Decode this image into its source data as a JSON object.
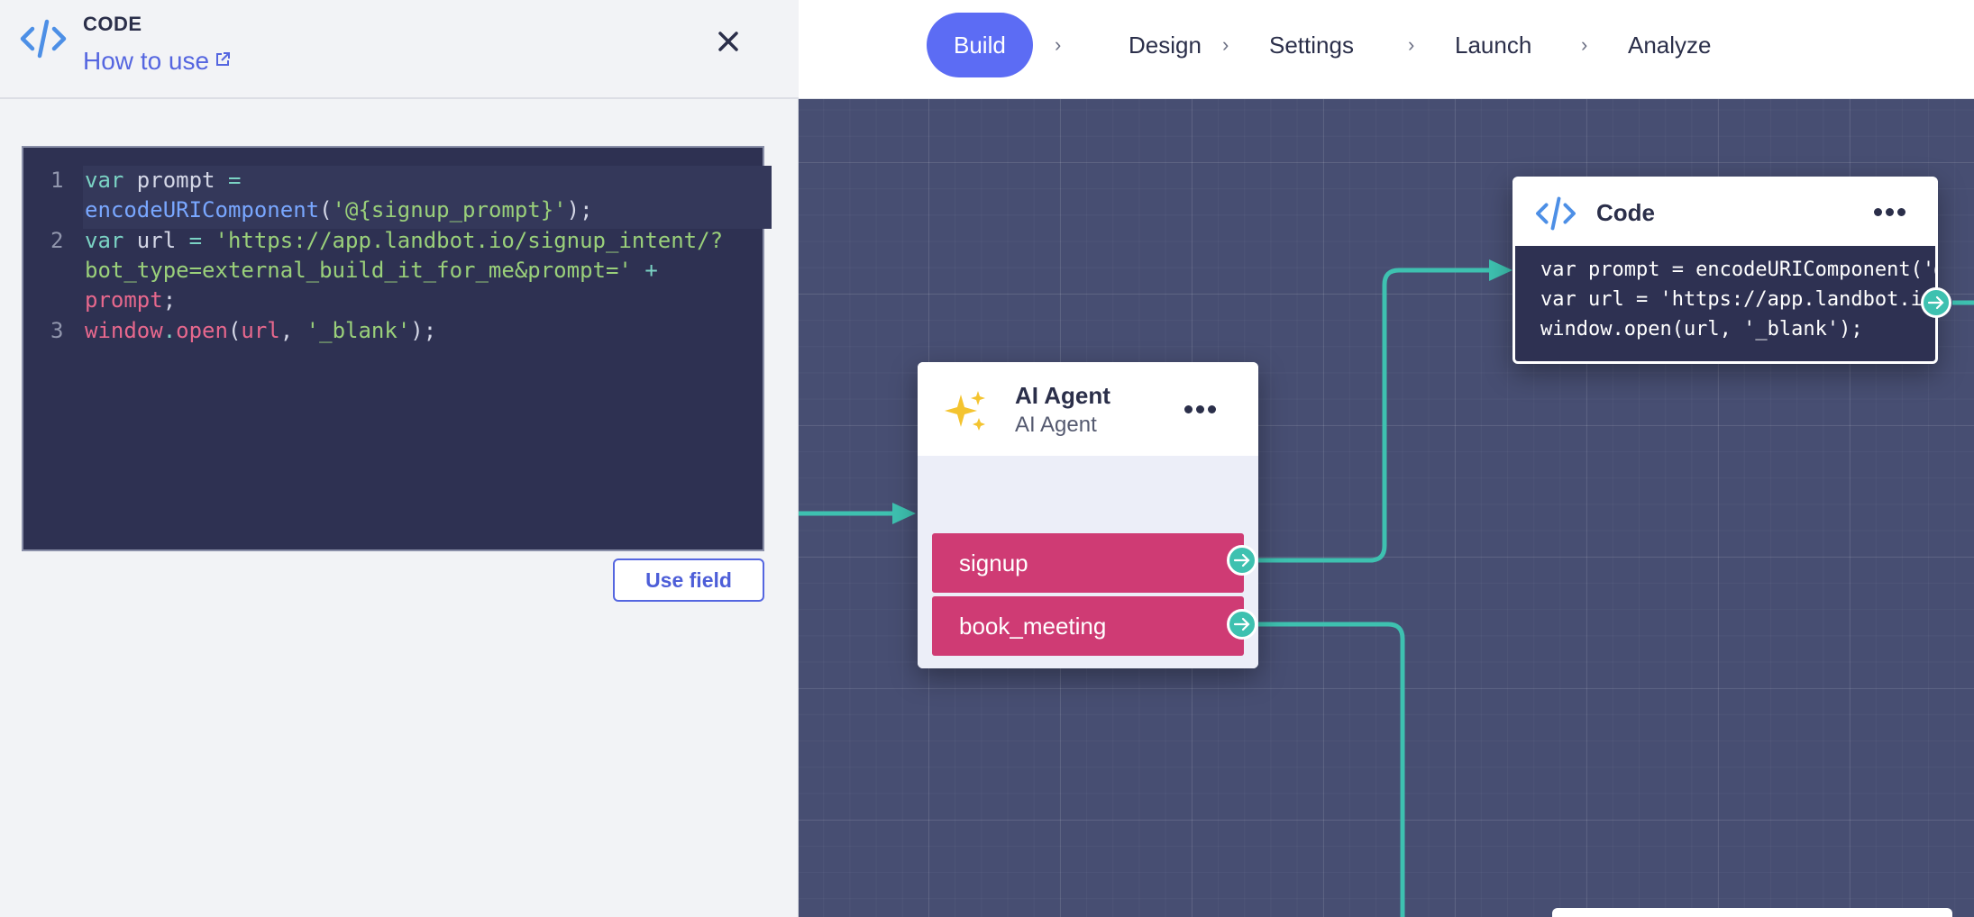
{
  "panel": {
    "title": "CODE",
    "how_to_use": "How to use",
    "use_field_label": "Use field",
    "code_lines": [
      {
        "num": "1"
      },
      {
        "num": "2"
      },
      {
        "num": "3"
      }
    ]
  },
  "nav": {
    "steps": [
      "Build",
      "Design",
      "Settings",
      "Launch",
      "Analyze"
    ],
    "separator": "›",
    "active": "Build"
  },
  "nodes": {
    "code": {
      "title": "Code",
      "preview": [
        "var prompt = encodeURIComponent('@{signup_prompt}');",
        "var url = 'https://app.landbot.io/signup_intent/?bot_type=external_build_it_for_me&prompt=' + prompt;",
        "window.open(url, '_blank');"
      ]
    },
    "ai_agent": {
      "title": "AI Agent",
      "subtitle": "AI Agent",
      "exits": [
        "signup",
        "book_meeting"
      ]
    }
  },
  "colors": {
    "accent": "#5c6cf4",
    "exit": "#cf3b74",
    "connector": "#3ec1b0",
    "canvas": "#474e72",
    "code_bg": "#2e3152"
  }
}
